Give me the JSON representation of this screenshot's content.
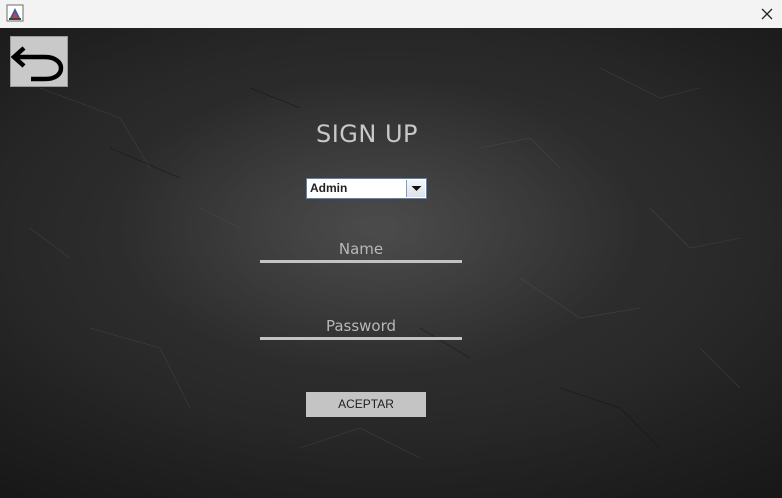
{
  "window": {
    "app_icon": "java-app-icon",
    "close_icon": "close-icon"
  },
  "back_button": {
    "icon": "undo-arrow-icon"
  },
  "form": {
    "title": "SIGN UP",
    "role_select": {
      "value": "Admin",
      "icon": "chevron-down-icon"
    },
    "name_label": "Name",
    "password_label": "Password",
    "accept_label": "ACEPTAR"
  },
  "colors": {
    "background": "#262626",
    "title_text": "#c8c8c8",
    "field_line": "#c3c3c3",
    "button_bg": "#c4c4c4"
  }
}
